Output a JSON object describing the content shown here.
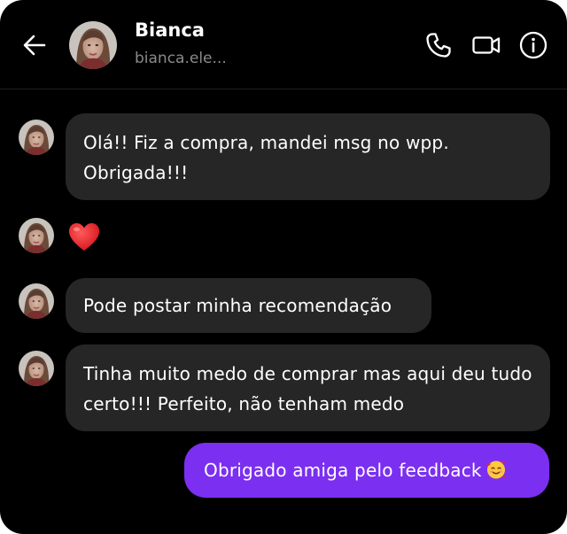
{
  "header": {
    "contact_name": "Bianca",
    "contact_handle": "bianca.ele...",
    "icons": [
      "back-arrow-icon",
      "phone-icon",
      "video-camera-icon",
      "info-icon"
    ]
  },
  "messages": [
    {
      "direction": "incoming",
      "text": "Olá!! Fiz a compra, mandei msg no wpp. Obrigada!!!"
    },
    {
      "direction": "incoming",
      "emoji": "red-heart"
    },
    {
      "direction": "incoming",
      "text": "Pode postar minha recomendação"
    },
    {
      "direction": "incoming",
      "text": "Tinha muito medo de comprar mas aqui deu tudo certo!!! Perfeito, não tenham medo"
    },
    {
      "direction": "outgoing",
      "text": "Obrigado amiga pelo feedback",
      "emoji": "smiling-face-with-hearts"
    }
  ],
  "colors": {
    "background": "#000000",
    "incoming_bubble": "#262626",
    "outgoing_bubble": "#7b2ff0",
    "text": "#ffffff",
    "handle_text": "#8a8a8a"
  }
}
